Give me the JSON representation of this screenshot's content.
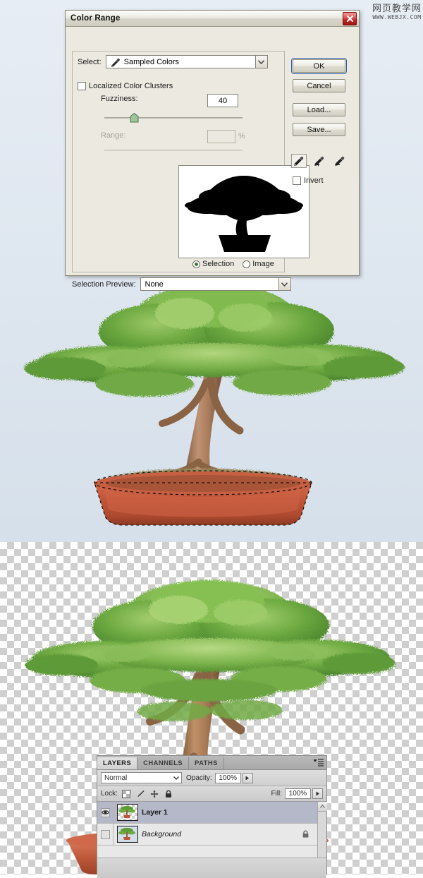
{
  "watermark": {
    "cn": "网页教学网",
    "url": "WWW.WEBJX.COM"
  },
  "dialog": {
    "title": "Color Range",
    "close_icon": "close-icon",
    "select_label": "Select:",
    "select_value": "Sampled Colors",
    "select_icon": "eyedropper-icon",
    "localized_label": "Localized Color Clusters",
    "localized_checked": false,
    "fuzziness_label": "Fuzziness:",
    "fuzziness_value": "40",
    "range_label": "Range:",
    "range_value": "",
    "range_unit": "%",
    "range_disabled": true,
    "radio_selection": "Selection",
    "radio_image": "Image",
    "radio_selected": "Selection",
    "selection_preview_label": "Selection Preview:",
    "selection_preview_value": "None",
    "buttons": {
      "ok": "OK",
      "cancel": "Cancel",
      "load": "Load...",
      "save": "Save..."
    },
    "eyedroppers": [
      {
        "name": "eyedropper-tool",
        "mod": "",
        "selected": true
      },
      {
        "name": "eyedropper-add-tool",
        "mod": "+",
        "selected": false
      },
      {
        "name": "eyedropper-subtract-tool",
        "mod": "−",
        "selected": false
      }
    ],
    "invert_label": "Invert",
    "invert_checked": false
  },
  "layers_panel": {
    "tabs": [
      {
        "label": "LAYERS",
        "active": true
      },
      {
        "label": "CHANNELS",
        "active": false
      },
      {
        "label": "PATHS",
        "active": false
      }
    ],
    "menu_icon": "panel-menu-icon",
    "blend_mode": "Normal",
    "opacity_label": "Opacity:",
    "opacity_value": "100%",
    "lock_label": "Lock:",
    "lock_icons": [
      "lock-transparency-icon",
      "lock-pixels-icon",
      "lock-position-icon",
      "lock-all-icon"
    ],
    "fill_label": "Fill:",
    "fill_value": "100%",
    "layers": [
      {
        "name": "Layer 1",
        "visible": true,
        "selected": true,
        "locked": false,
        "italic": false
      },
      {
        "name": "Background",
        "visible": false,
        "selected": false,
        "locked": true,
        "italic": true
      }
    ]
  },
  "canvas": {
    "top_background": "#dfe7f0",
    "bottom_background": "transparent-checkerboard",
    "subject": "bonsai-tree",
    "pot_color": "#c0543a"
  }
}
